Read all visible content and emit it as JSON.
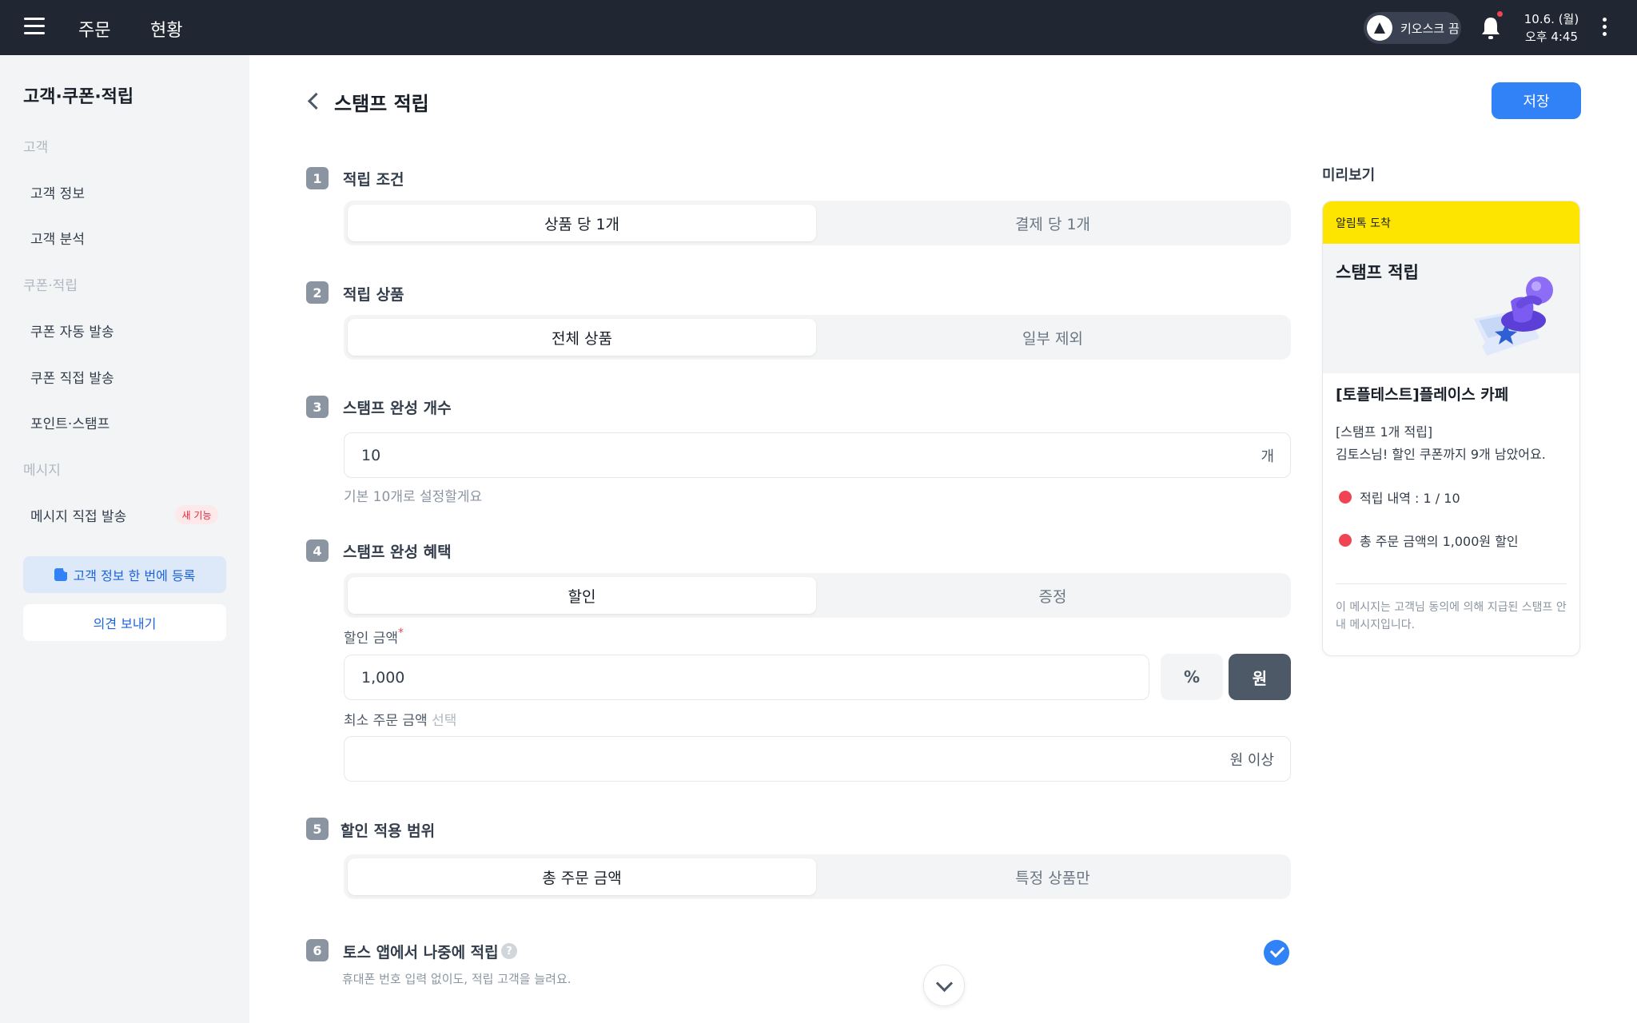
{
  "topbar": {
    "nav": [
      "주문",
      "현황"
    ],
    "kiosk_label": "키오스크 끔",
    "date": "10.6. (월)",
    "time": "오후 4:45"
  },
  "sidebar": {
    "title": "고객·쿠폰·적립",
    "sections": [
      {
        "label": "고객",
        "items": [
          "고객 정보",
          "고객 분석"
        ]
      },
      {
        "label": "쿠폰·적립",
        "items": [
          "쿠폰 자동 발송",
          "쿠폰 직접 발송",
          "포인트·스탬프"
        ]
      },
      {
        "label": "메시지",
        "items": [
          "메시지 직접 발송"
        ]
      }
    ],
    "new_badge": "새 기능",
    "register_button": "고객 정보 한 번에 등록",
    "feedback_button": "의견 보내기"
  },
  "page": {
    "title": "스탬프 적립",
    "save_label": "저장"
  },
  "steps": [
    {
      "num": "1",
      "label": "적립 조건",
      "options": [
        "상품 당 1개",
        "결제 당 1개"
      ],
      "selected": 0
    },
    {
      "num": "2",
      "label": "적립 상품",
      "options": [
        "전체 상품",
        "일부 제외"
      ],
      "selected": 0
    },
    {
      "num": "3",
      "label": "스탬프 완성 개수",
      "value": "10",
      "suffix": "개",
      "hint": "기본 10개로 설정할게요"
    },
    {
      "num": "4",
      "label": "스탬프 완성 혜택",
      "options": [
        "할인",
        "증정"
      ],
      "selected": 0,
      "discount_label": "할인 금액",
      "required_mark": "*",
      "discount_value": "1,000",
      "unit_percent": "%",
      "unit_won": "원",
      "min_order_label": "최소 주문 금액",
      "min_order_optional": "선택",
      "min_order_suffix": "원 이상"
    },
    {
      "num": "5",
      "label": "할인 적용 범위",
      "options": [
        "총 주문 금액",
        "특정 상품만"
      ],
      "selected": 0
    },
    {
      "num": "6",
      "label": "토스 앱에서 나중에 적립",
      "help": "?",
      "hint": "휴대폰 번호 입력 없이도, 적립 고객을 늘려요.",
      "checked": true
    }
  ],
  "preview": {
    "title": "미리보기",
    "header": "알림톡 도착",
    "card_title": "스탬프 적립",
    "shop_name": "[토플테스트]플레이스 카페",
    "message_line1": "[스탬프 1개 적립]",
    "message_line2": "김토스님! 할인 쿠폰까지 9개 남았어요.",
    "bullet1": "적립 내역 : 1 / 10",
    "bullet2": "총 주문 금액의 1,000원 할인",
    "footer": "이 메시지는 고객님 동의에 의해 지급된 스탬프 안내 메시지입니다."
  },
  "colors": {
    "topbar": "#202632",
    "accent": "#3182f6",
    "kakao_yellow": "#fee500",
    "bullet_red": "#f04452"
  },
  "icons": [
    "menu-icon",
    "bell-icon",
    "kebab-icon",
    "back-chevron-icon",
    "help-icon",
    "check-icon",
    "chevron-down-icon",
    "stamp-illustration"
  ]
}
